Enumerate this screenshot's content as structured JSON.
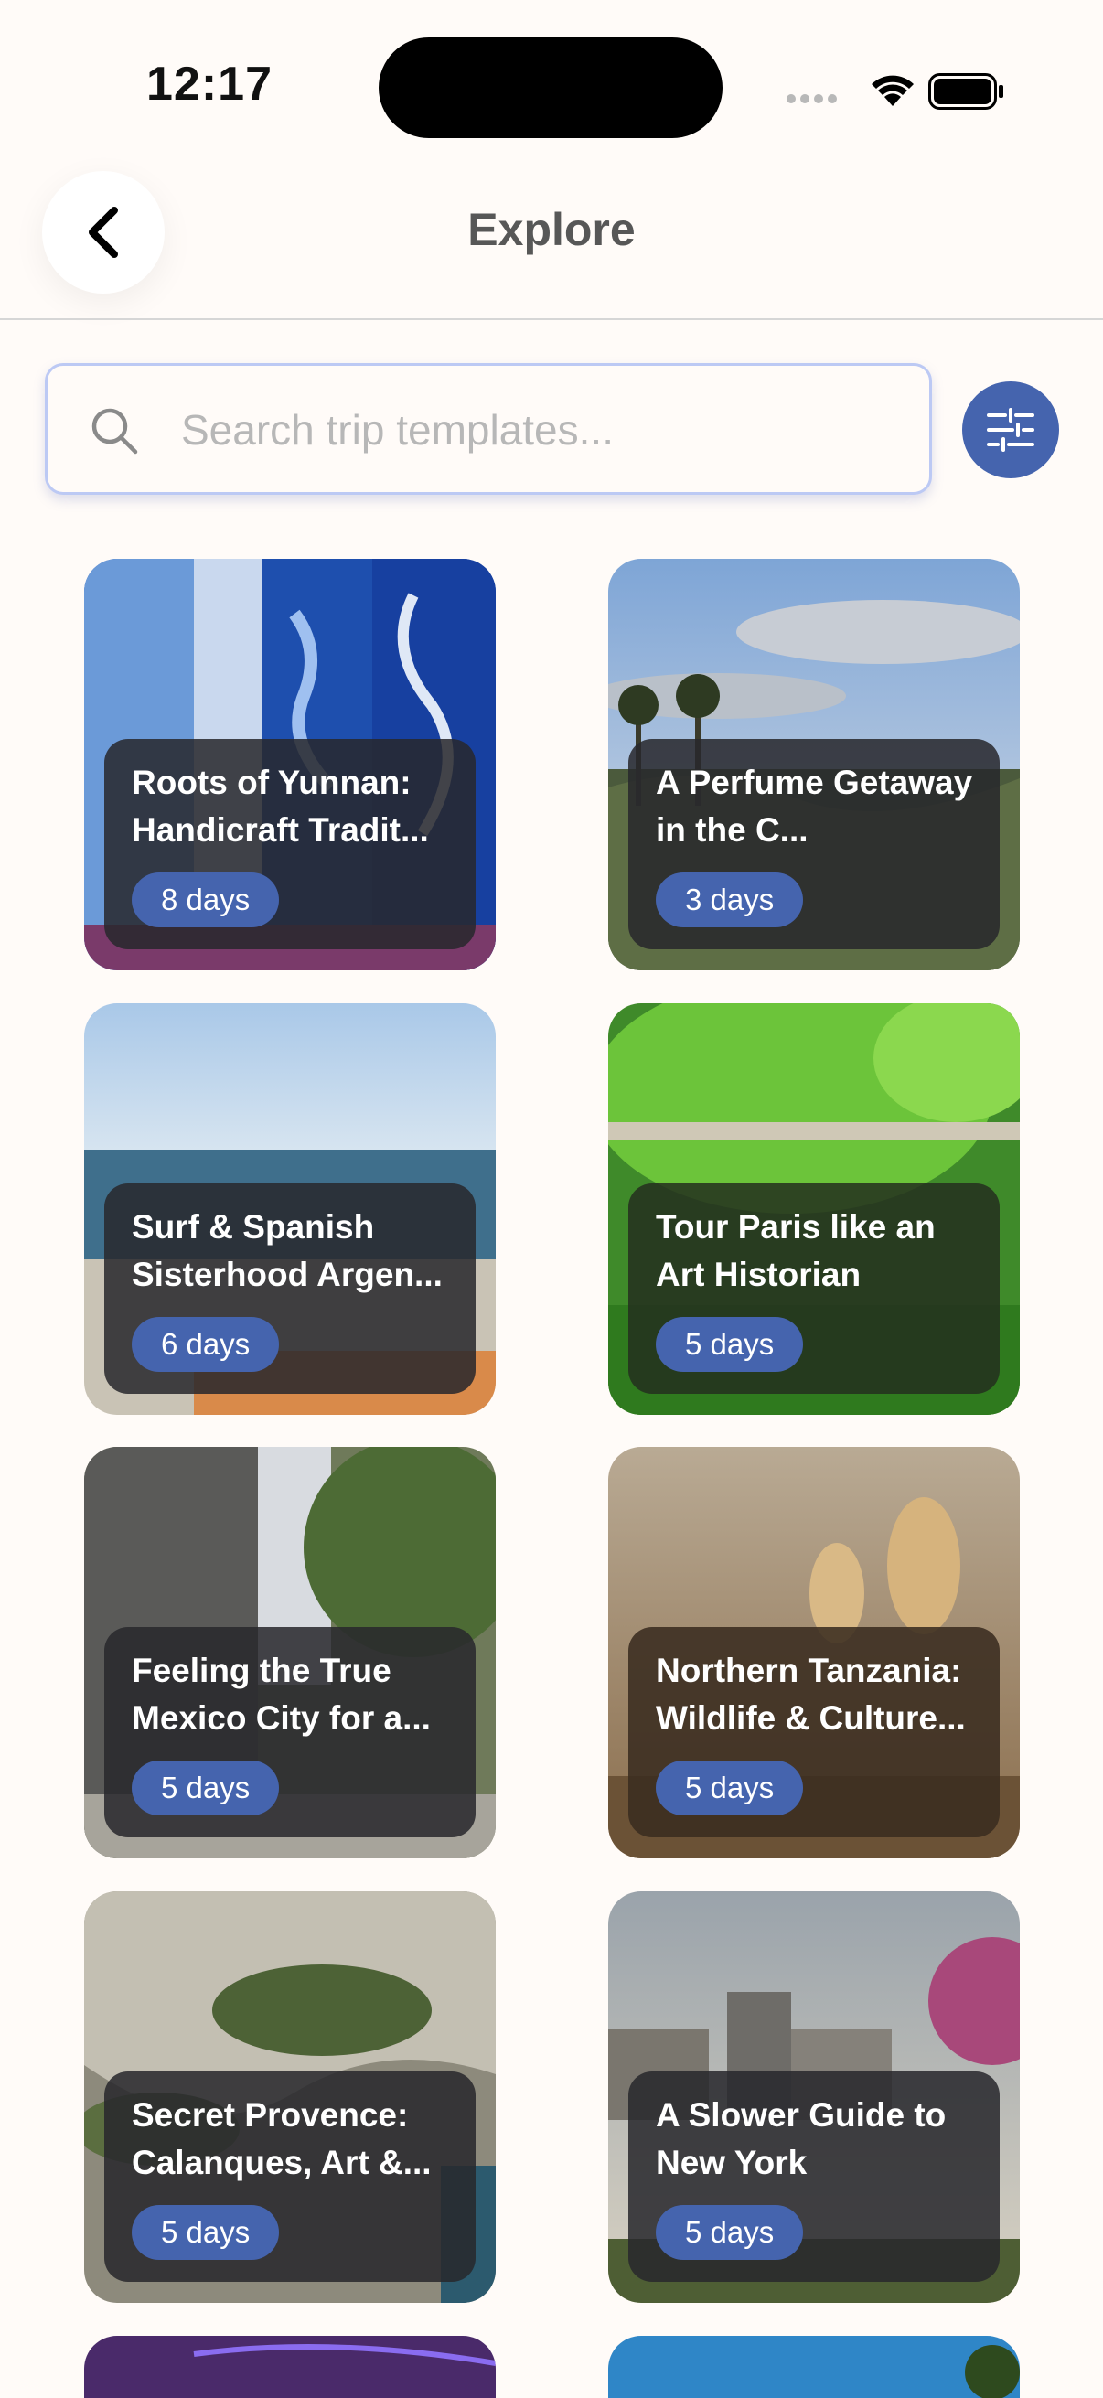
{
  "status_bar": {
    "time": "12:17"
  },
  "nav": {
    "title": "Explore",
    "back_icon": "chevron-left-icon"
  },
  "search": {
    "placeholder": "Search trip templates...",
    "value": "",
    "icon": "search-icon",
    "filter_icon": "sliders-icon"
  },
  "colors": {
    "accent": "#4564ae",
    "background": "#fffbf8",
    "card_overlay": "#28282c"
  },
  "trips": [
    {
      "title": "Roots of Yunnan: Handicraft Tradit...",
      "days": "8 days"
    },
    {
      "title": "A Perfume Getaway in the C...",
      "days": "3 days"
    },
    {
      "title": "Surf & Spanish Sisterhood Argen...",
      "days": "6 days"
    },
    {
      "title": "Tour Paris like an Art Historian",
      "days": "5 days"
    },
    {
      "title": "Feeling the True Mexico City for a...",
      "days": "5 days"
    },
    {
      "title": "Northern Tanzania: Wildlife & Culture...",
      "days": "5 days"
    },
    {
      "title": "Secret Provence: Calanques, Art &...",
      "days": "5 days"
    },
    {
      "title": "A Slower Guide to New York",
      "days": "5 days"
    }
  ]
}
